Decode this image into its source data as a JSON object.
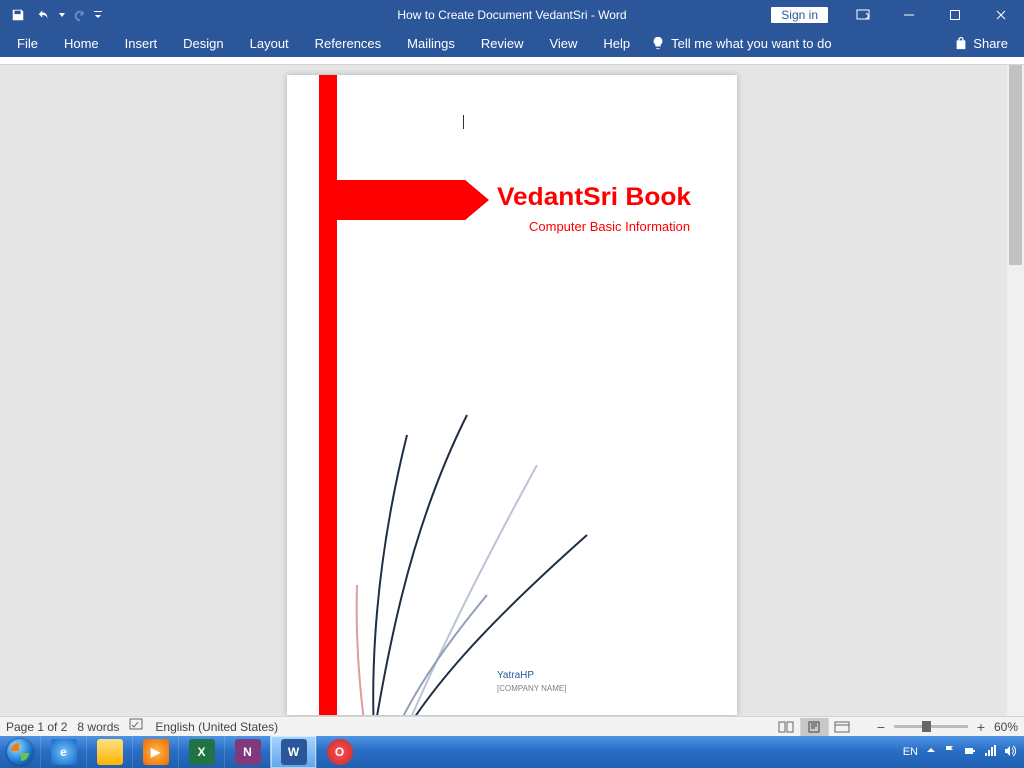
{
  "titlebar": {
    "title": "How to Create Document VedantSri  -  Word",
    "signin": "Sign in"
  },
  "ribbon": {
    "tabs": [
      "File",
      "Home",
      "Insert",
      "Design",
      "Layout",
      "References",
      "Mailings",
      "Review",
      "View",
      "Help"
    ],
    "tellme": "Tell me what you want to do",
    "share": "Share"
  },
  "document": {
    "title": "VedantSri Book",
    "subtitle": "Computer Basic Information",
    "author": "YatraHP",
    "company": "[COMPANY NAME]"
  },
  "status": {
    "page": "Page 1 of 2",
    "words": "8 words",
    "language": "English (United States)",
    "zoom": "60%"
  },
  "taskbar": {
    "lang": "EN"
  }
}
